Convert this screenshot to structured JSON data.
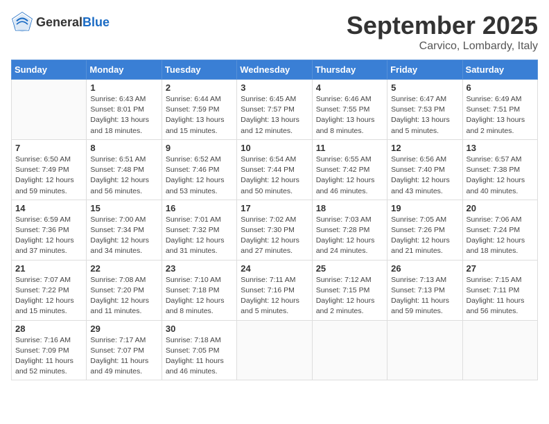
{
  "header": {
    "logo_general": "General",
    "logo_blue": "Blue",
    "month_title": "September 2025",
    "location": "Carvico, Lombardy, Italy"
  },
  "weekdays": [
    "Sunday",
    "Monday",
    "Tuesday",
    "Wednesday",
    "Thursday",
    "Friday",
    "Saturday"
  ],
  "weeks": [
    [
      {
        "day": "",
        "info": ""
      },
      {
        "day": "1",
        "info": "Sunrise: 6:43 AM\nSunset: 8:01 PM\nDaylight: 13 hours\nand 18 minutes."
      },
      {
        "day": "2",
        "info": "Sunrise: 6:44 AM\nSunset: 7:59 PM\nDaylight: 13 hours\nand 15 minutes."
      },
      {
        "day": "3",
        "info": "Sunrise: 6:45 AM\nSunset: 7:57 PM\nDaylight: 13 hours\nand 12 minutes."
      },
      {
        "day": "4",
        "info": "Sunrise: 6:46 AM\nSunset: 7:55 PM\nDaylight: 13 hours\nand 8 minutes."
      },
      {
        "day": "5",
        "info": "Sunrise: 6:47 AM\nSunset: 7:53 PM\nDaylight: 13 hours\nand 5 minutes."
      },
      {
        "day": "6",
        "info": "Sunrise: 6:49 AM\nSunset: 7:51 PM\nDaylight: 13 hours\nand 2 minutes."
      }
    ],
    [
      {
        "day": "7",
        "info": "Sunrise: 6:50 AM\nSunset: 7:49 PM\nDaylight: 12 hours\nand 59 minutes."
      },
      {
        "day": "8",
        "info": "Sunrise: 6:51 AM\nSunset: 7:48 PM\nDaylight: 12 hours\nand 56 minutes."
      },
      {
        "day": "9",
        "info": "Sunrise: 6:52 AM\nSunset: 7:46 PM\nDaylight: 12 hours\nand 53 minutes."
      },
      {
        "day": "10",
        "info": "Sunrise: 6:54 AM\nSunset: 7:44 PM\nDaylight: 12 hours\nand 50 minutes."
      },
      {
        "day": "11",
        "info": "Sunrise: 6:55 AM\nSunset: 7:42 PM\nDaylight: 12 hours\nand 46 minutes."
      },
      {
        "day": "12",
        "info": "Sunrise: 6:56 AM\nSunset: 7:40 PM\nDaylight: 12 hours\nand 43 minutes."
      },
      {
        "day": "13",
        "info": "Sunrise: 6:57 AM\nSunset: 7:38 PM\nDaylight: 12 hours\nand 40 minutes."
      }
    ],
    [
      {
        "day": "14",
        "info": "Sunrise: 6:59 AM\nSunset: 7:36 PM\nDaylight: 12 hours\nand 37 minutes."
      },
      {
        "day": "15",
        "info": "Sunrise: 7:00 AM\nSunset: 7:34 PM\nDaylight: 12 hours\nand 34 minutes."
      },
      {
        "day": "16",
        "info": "Sunrise: 7:01 AM\nSunset: 7:32 PM\nDaylight: 12 hours\nand 31 minutes."
      },
      {
        "day": "17",
        "info": "Sunrise: 7:02 AM\nSunset: 7:30 PM\nDaylight: 12 hours\nand 27 minutes."
      },
      {
        "day": "18",
        "info": "Sunrise: 7:03 AM\nSunset: 7:28 PM\nDaylight: 12 hours\nand 24 minutes."
      },
      {
        "day": "19",
        "info": "Sunrise: 7:05 AM\nSunset: 7:26 PM\nDaylight: 12 hours\nand 21 minutes."
      },
      {
        "day": "20",
        "info": "Sunrise: 7:06 AM\nSunset: 7:24 PM\nDaylight: 12 hours\nand 18 minutes."
      }
    ],
    [
      {
        "day": "21",
        "info": "Sunrise: 7:07 AM\nSunset: 7:22 PM\nDaylight: 12 hours\nand 15 minutes."
      },
      {
        "day": "22",
        "info": "Sunrise: 7:08 AM\nSunset: 7:20 PM\nDaylight: 12 hours\nand 11 minutes."
      },
      {
        "day": "23",
        "info": "Sunrise: 7:10 AM\nSunset: 7:18 PM\nDaylight: 12 hours\nand 8 minutes."
      },
      {
        "day": "24",
        "info": "Sunrise: 7:11 AM\nSunset: 7:16 PM\nDaylight: 12 hours\nand 5 minutes."
      },
      {
        "day": "25",
        "info": "Sunrise: 7:12 AM\nSunset: 7:15 PM\nDaylight: 12 hours\nand 2 minutes."
      },
      {
        "day": "26",
        "info": "Sunrise: 7:13 AM\nSunset: 7:13 PM\nDaylight: 11 hours\nand 59 minutes."
      },
      {
        "day": "27",
        "info": "Sunrise: 7:15 AM\nSunset: 7:11 PM\nDaylight: 11 hours\nand 56 minutes."
      }
    ],
    [
      {
        "day": "28",
        "info": "Sunrise: 7:16 AM\nSunset: 7:09 PM\nDaylight: 11 hours\nand 52 minutes."
      },
      {
        "day": "29",
        "info": "Sunrise: 7:17 AM\nSunset: 7:07 PM\nDaylight: 11 hours\nand 49 minutes."
      },
      {
        "day": "30",
        "info": "Sunrise: 7:18 AM\nSunset: 7:05 PM\nDaylight: 11 hours\nand 46 minutes."
      },
      {
        "day": "",
        "info": ""
      },
      {
        "day": "",
        "info": ""
      },
      {
        "day": "",
        "info": ""
      },
      {
        "day": "",
        "info": ""
      }
    ]
  ]
}
